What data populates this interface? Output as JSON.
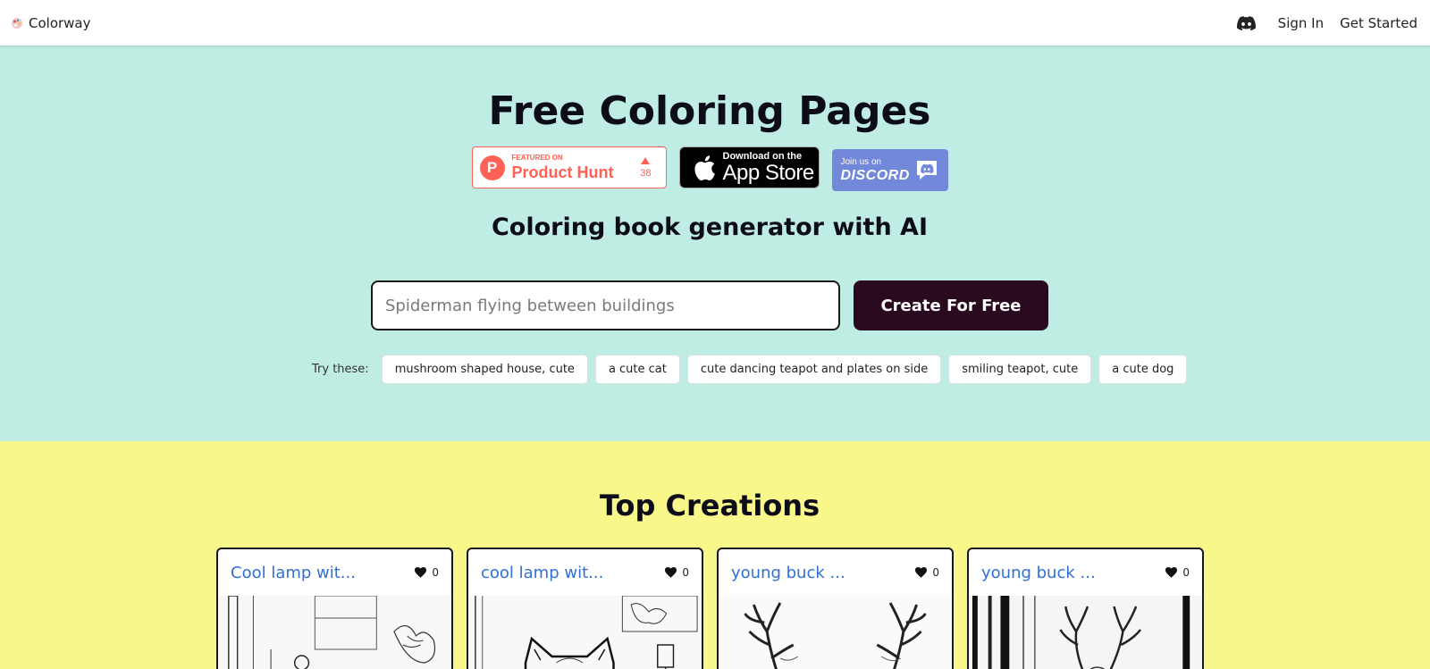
{
  "nav": {
    "brand": "Colorway",
    "sign_in": "Sign In",
    "get_started": "Get Started",
    "discord_icon": "discord-icon"
  },
  "hero": {
    "title": "Free Coloring Pages",
    "product_hunt": {
      "featured": "FEATURED ON",
      "name": "Product Hunt",
      "votes": "38",
      "letter": "P"
    },
    "app_store": {
      "small": "Download on the",
      "big": "App Store"
    },
    "discord": {
      "small": "Join us on",
      "big": "DISCORD"
    },
    "subtitle": "Coloring book generator with AI",
    "search_placeholder": "Spiderman flying between buildings",
    "create_button": "Create For Free",
    "try_label": "Try these:",
    "suggestions": [
      "mushroom shaped house, cute",
      "a cute cat",
      "cute dancing teapot and plates on side",
      "smiling teapot, cute",
      "a cute dog"
    ]
  },
  "creations": {
    "title": "Top Creations",
    "cards": [
      {
        "title": "Cool lamp wit...",
        "likes": "0"
      },
      {
        "title": "cool lamp wit...",
        "likes": "0"
      },
      {
        "title": "young buck ...",
        "likes": "0"
      },
      {
        "title": "young buck ...",
        "likes": "0"
      }
    ]
  },
  "colors": {
    "hero_bg": "#c0ede3",
    "creations_bg": "#f7f78a",
    "button_bg": "#2a0a1f",
    "link": "#2f6fd6",
    "product_hunt": "#ff6154",
    "discord": "#7289da"
  }
}
